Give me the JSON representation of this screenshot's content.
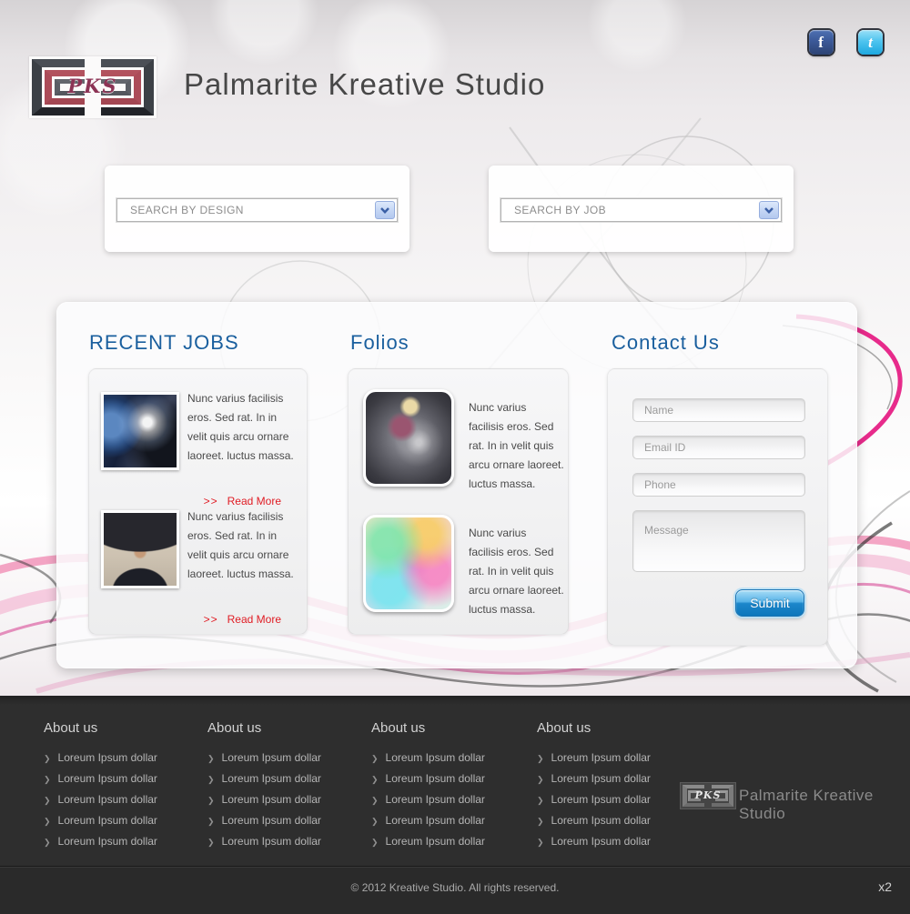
{
  "header": {
    "title": "Palmarite Kreative Studio",
    "logo_text": "PKS",
    "social": {
      "facebook_glyph": "f",
      "twitter_glyph": "t"
    }
  },
  "search": {
    "by_design_label": "SEARCH BY DESIGN",
    "by_job_label": "SEARCH BY JOB"
  },
  "sections": {
    "recent_jobs": {
      "heading": "RECENT JOBS",
      "items": [
        {
          "text": "Nunc varius facilisis eros. Sed rat. In in velit quis arcu ornare laoreet. luctus massa.",
          "link_prefix": ">>",
          "link_label": "Read More"
        },
        {
          "text": "Nunc varius facilisis eros. Sed rat. In in velit quis arcu ornare laoreet. luctus massa.",
          "link_prefix": ">>",
          "link_label": "Read More"
        }
      ]
    },
    "folios": {
      "heading": "Folios",
      "items": [
        {
          "text": "Nunc varius facilisis eros. Sed rat. In in velit quis arcu ornare laoreet. luctus massa."
        },
        {
          "text": "Nunc varius facilisis eros. Sed rat. In in velit quis arcu ornare laoreet. luctus massa."
        }
      ]
    },
    "contact": {
      "heading": "Contact Us",
      "fields": {
        "name_placeholder": "Name",
        "email_placeholder": "Email ID",
        "phone_placeholder": "Phone",
        "message_placeholder": "Message"
      },
      "submit_label": "Submit"
    }
  },
  "footer": {
    "columns": [
      {
        "heading": "About us",
        "links": [
          "Loreum Ipsum dollar",
          "Loreum Ipsum dollar",
          "Loreum Ipsum dollar",
          "Loreum Ipsum dollar",
          "Loreum Ipsum dollar"
        ]
      },
      {
        "heading": "About us",
        "links": [
          "Loreum Ipsum dollar",
          "Loreum Ipsum dollar",
          "Loreum Ipsum dollar",
          "Loreum Ipsum dollar",
          "Loreum Ipsum dollar"
        ]
      },
      {
        "heading": "About us",
        "links": [
          "Loreum Ipsum dollar",
          "Loreum Ipsum dollar",
          "Loreum Ipsum dollar",
          "Loreum Ipsum dollar",
          "Loreum Ipsum dollar"
        ]
      },
      {
        "heading": "About us",
        "links": [
          "Loreum Ipsum dollar",
          "Loreum Ipsum dollar",
          "Loreum Ipsum dollar",
          "Loreum Ipsum dollar",
          "Loreum Ipsum dollar"
        ]
      }
    ],
    "logo_text": "PKS",
    "brand": "Palmarite Kreative Studio"
  },
  "bottom_bar": {
    "copyright": "© 2012 Kreative Studio. All rights reserved.",
    "scale_label": "x2"
  },
  "colors": {
    "heading_blue": "#1a5f9e",
    "link_red": "#e01b23",
    "facebook_blue": "#3b5998",
    "twitter_blue": "#1da8e0",
    "footer_bg": "#2e2e2e",
    "logo_rose": "#b2525e"
  }
}
